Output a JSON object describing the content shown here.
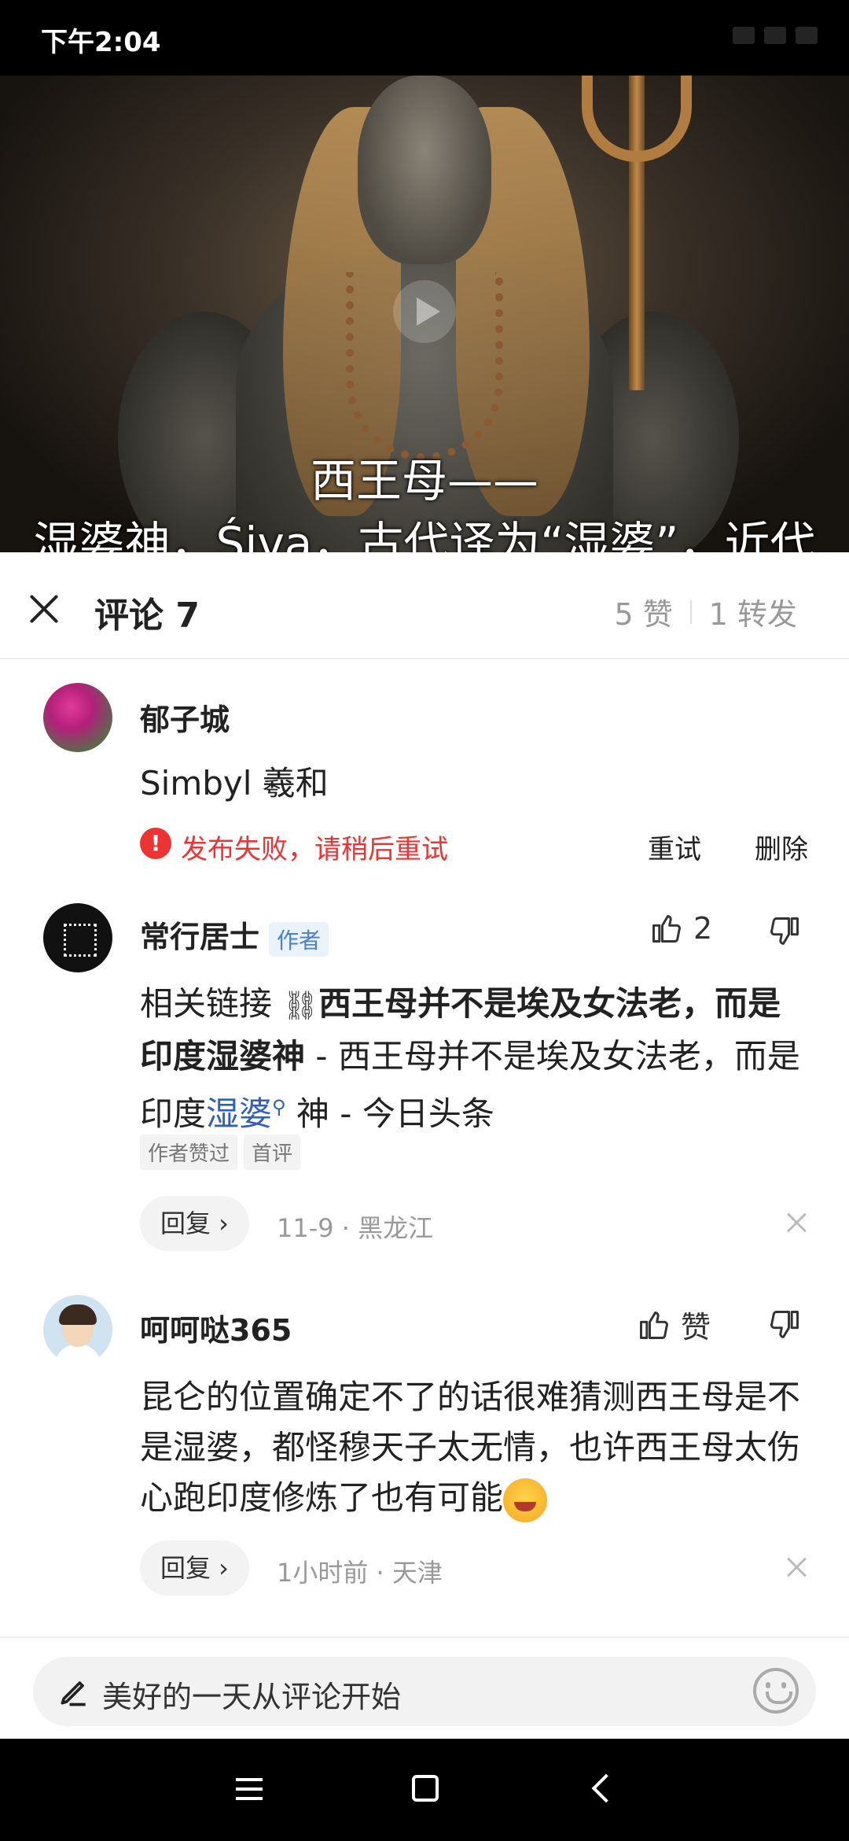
{
  "status_bar": {
    "time": "下午2:04"
  },
  "video": {
    "subtitle_line1": "西王母——",
    "subtitle_line2": "湿婆神，Śiva，古代译为“湿婆”，近代"
  },
  "header": {
    "title": "评论 7",
    "likes": "5 赞",
    "shares": "1 转发"
  },
  "comments": [
    {
      "username": "郁子城",
      "text": "Simbyl 羲和",
      "fail_text": "发布失败，请稍后重试",
      "retry_label": "重试",
      "delete_label": "删除"
    },
    {
      "username": "常行居士",
      "author_tag": "作者",
      "like_count": "2",
      "text_prefix": "相关链接 ",
      "text_bold": "西王母并不是埃及女法老，而是印度湿婆神",
      "text_mid": " - 西王母并不是埃及女法老，而是印度",
      "text_link": "湿婆",
      "text_end": " 神 - 今日头条",
      "tags": [
        "作者赞过",
        "首评"
      ],
      "reply_label": "回复 ›",
      "meta": "11-9 · 黑龙江"
    },
    {
      "username": "呵呵哒365",
      "like_label": "赞",
      "text": "昆仑的位置确定不了的话很难猜测西王母是不是湿婆，都怪穆天子太无情，也许西王母太伤心跑印度修炼了也有可能",
      "reply_label": "回复 ›",
      "meta": "1小时前 · 天津"
    }
  ],
  "input": {
    "placeholder": "美好的一天从评论开始"
  },
  "colors": {
    "error": "#e33333",
    "link": "#2f5fbf",
    "author_tag": "#4a7fd1"
  }
}
